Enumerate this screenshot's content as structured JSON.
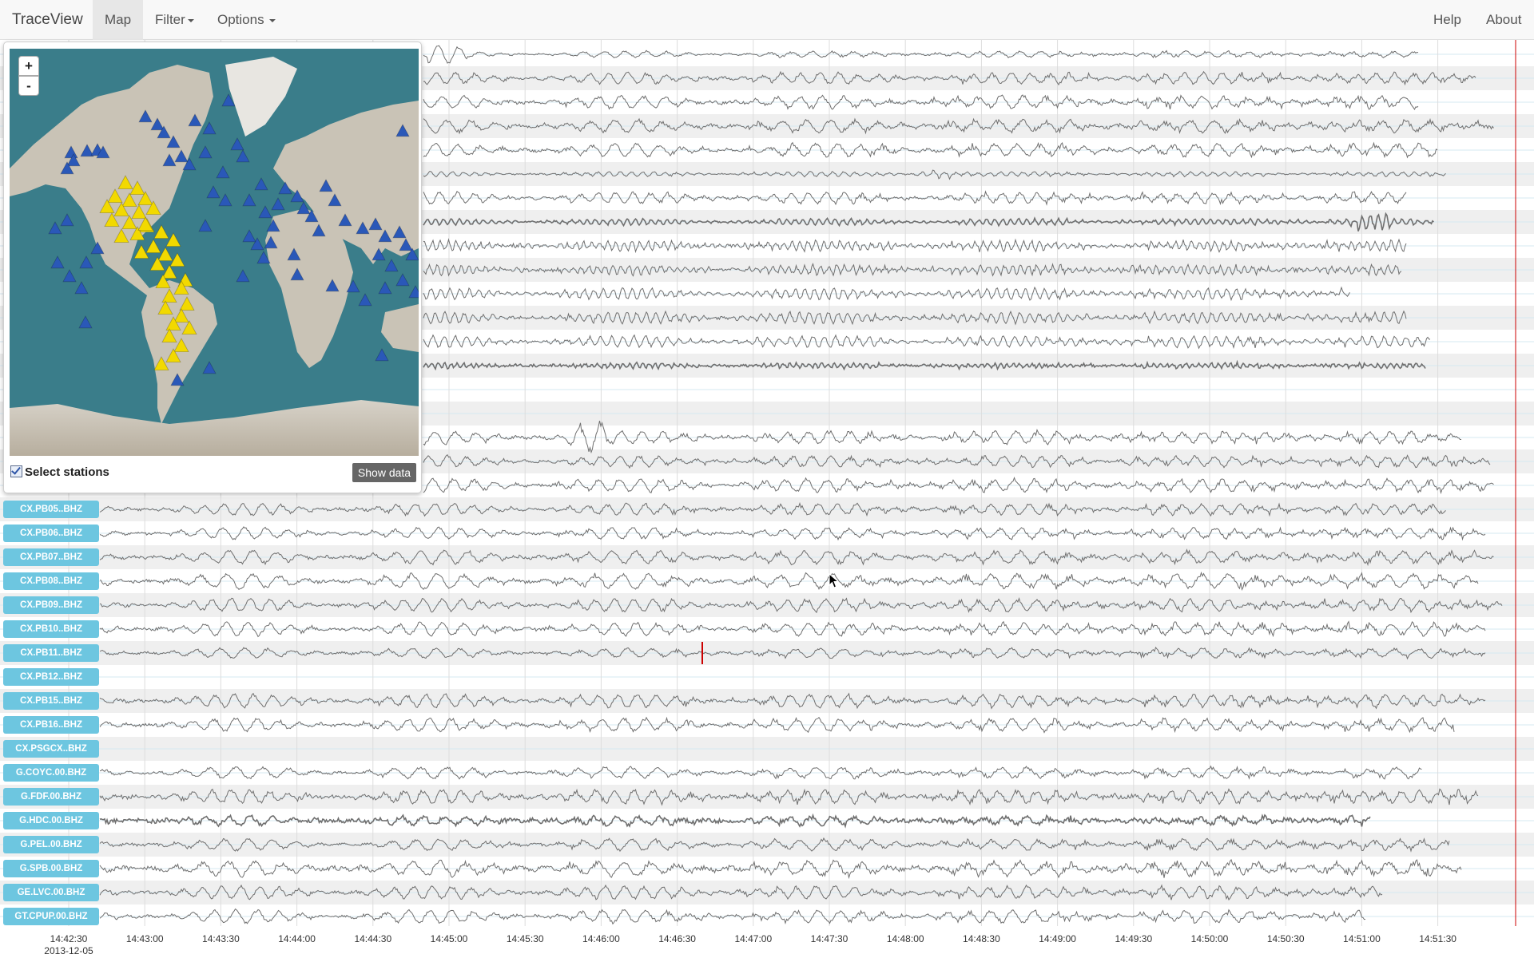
{
  "navbar": {
    "brand": "TraceView",
    "map": "Map",
    "filter": "Filter",
    "options": "Options",
    "help": "Help",
    "about": "About"
  },
  "map_panel": {
    "zoom_in": "+",
    "zoom_out": "-",
    "select_label": "Select stations",
    "select_checked": true,
    "show_data": "Show data",
    "colors": {
      "ocean": "#3a7d8a",
      "land": "#c9c3b6",
      "ice": "#e6e6e6",
      "selected_marker": "#f2d900",
      "station_marker": "#2a58b8"
    }
  },
  "stations": [
    "CX.PB05..BHZ",
    "CX.PB06..BHZ",
    "CX.PB07..BHZ",
    "CX.PB08..BHZ",
    "CX.PB09..BHZ",
    "CX.PB10..BHZ",
    "CX.PB11..BHZ",
    "CX.PB12..BHZ",
    "CX.PB15..BHZ",
    "CX.PB16..BHZ",
    "CX.PSGCX..BHZ",
    "G.COYC.00.BHZ",
    "G.FDF.00.BHZ",
    "G.HDC.00.BHZ",
    "G.PEL.00.BHZ",
    "G.SPB.00.BHZ",
    "GE.LVC.00.BHZ",
    "GT.CPUP.00.BHZ"
  ],
  "time_axis": {
    "date": "2013-12-05",
    "ticks": [
      "14:42:30",
      "14:43:00",
      "14:43:30",
      "14:44:00",
      "14:44:30",
      "14:45:00",
      "14:45:30",
      "14:46:00",
      "14:46:30",
      "14:47:00",
      "14:47:30",
      "14:48:00",
      "14:48:30",
      "14:49:00",
      "14:49:30",
      "14:50:00",
      "14:50:30",
      "14:51:00",
      "14:51:30"
    ]
  },
  "colors": {
    "trace": "#6f6f6f",
    "label_bg": "#6dc6e0",
    "stripe": "#efefef",
    "marker": "#cc0000"
  }
}
